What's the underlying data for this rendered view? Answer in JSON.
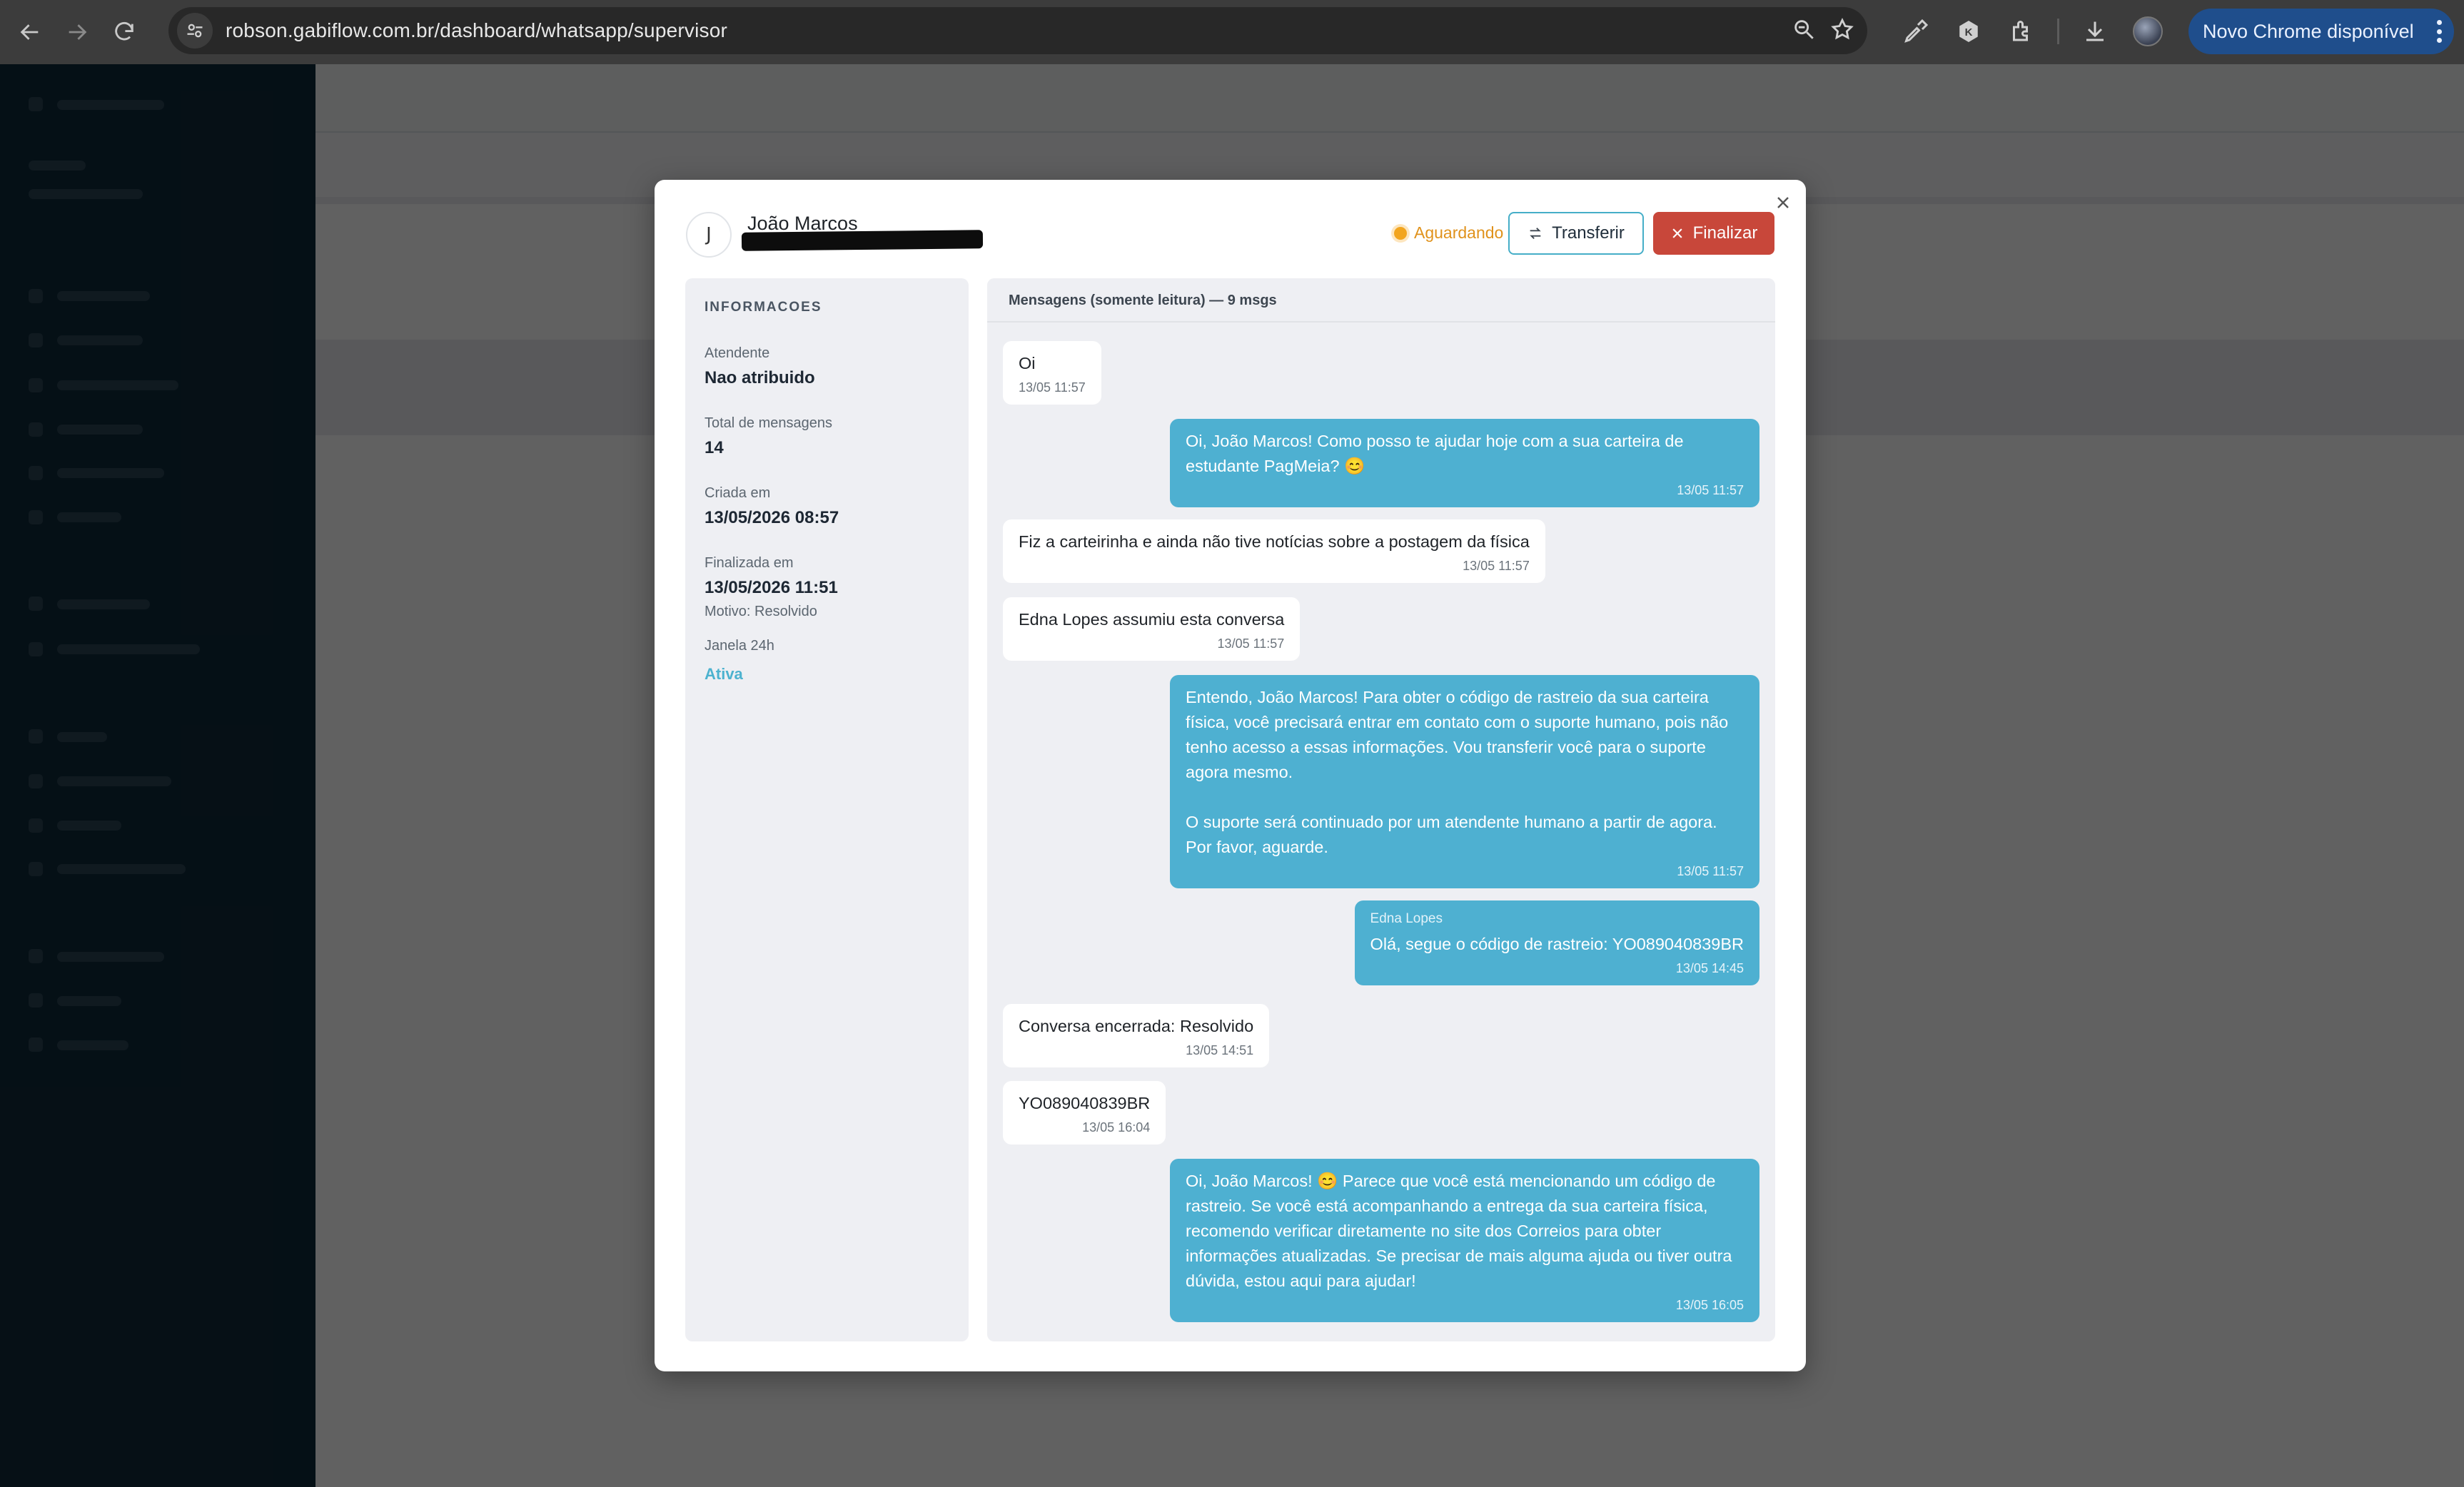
{
  "browser": {
    "url": "robson.gabiflow.com.br/dashboard/whatsapp/supervisor",
    "update_label": "Novo Chrome disponível"
  },
  "modal": {
    "avatar_initial": "J",
    "contact_name": "João Marcos",
    "status": "Aguardando",
    "transfer_label": "Transferir",
    "finalize_label": "Finalizar",
    "colors": {
      "accent": "#4eb0d1",
      "danger": "#c8473a",
      "warning": "#f2a51f"
    }
  },
  "info": {
    "title": "INFORMACOES",
    "atendente_label": "Atendente",
    "atendente_value": "Nao atribuido",
    "total_label": "Total de mensagens",
    "total_value": "14",
    "criada_label": "Criada em",
    "criada_value": "13/05/2026 08:57",
    "finalizada_label": "Finalizada em",
    "finalizada_value": "13/05/2026 11:51",
    "motivo": "Motivo: Resolvido",
    "janela_label": "Janela 24h",
    "janela_value": "Ativa"
  },
  "messages": {
    "header": "Mensagens (somente leitura) — 9 msgs",
    "items": [
      {
        "dir": "in",
        "text": "Oi",
        "time": "13/05 11:57"
      },
      {
        "dir": "out",
        "text": "Oi, João Marcos! Como posso te ajudar hoje com a sua carteira de estudante PagMeia? 😊",
        "time": "13/05 11:57"
      },
      {
        "dir": "in",
        "text": "Fiz a carteirinha e ainda não tive notícias sobre a postagem da física",
        "time": "13/05 11:57"
      },
      {
        "dir": "in",
        "text": "Edna Lopes assumiu esta conversa",
        "time": "13/05 11:57"
      },
      {
        "dir": "out",
        "text": "Entendo, João Marcos! Para obter o código de rastreio da sua carteira física, você precisará entrar em contato com o suporte humano, pois não tenho acesso a essas informações. Vou transferir você para o suporte agora mesmo.\n\nO suporte será continuado por um atendente humano a partir de agora. Por favor, aguarde.",
        "time": "13/05 11:57"
      },
      {
        "dir": "out",
        "sender": "Edna Lopes",
        "text": "Olá, segue o código de rastreio: YO089040839BR",
        "time": "13/05 14:45"
      },
      {
        "dir": "in",
        "text": "Conversa encerrada: Resolvido",
        "time": "13/05 14:51"
      },
      {
        "dir": "in",
        "text": "YO089040839BR",
        "time": "13/05 16:04"
      },
      {
        "dir": "out",
        "text": "Oi, João Marcos! 😊 Parece que você está mencionando um código de rastreio. Se você está acompanhando a entrega da sua carteira física, recomendo verificar diretamente no site dos Correios para obter informações atualizadas. Se precisar de mais alguma ajuda ou tiver outra dúvida, estou aqui para ajudar!",
        "time": "13/05 16:05"
      }
    ]
  }
}
